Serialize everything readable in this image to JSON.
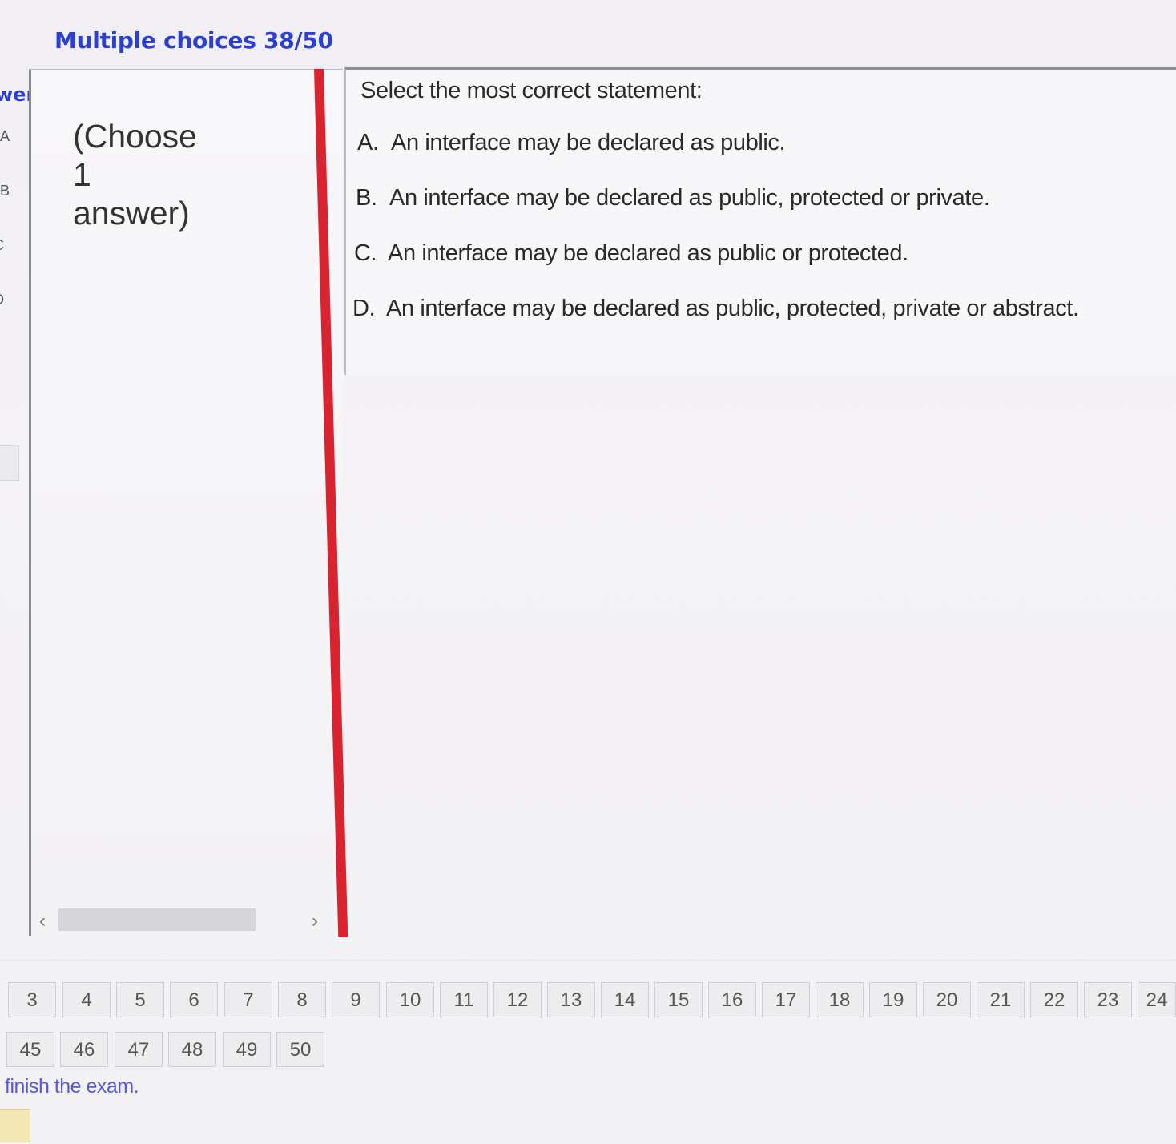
{
  "header": {
    "title": "Multiple choices 38/50"
  },
  "left_fragments": {
    "answer_label": "wer",
    "letters": [
      "A",
      "B",
      "C",
      "D"
    ]
  },
  "instruction": {
    "lines": [
      "(Choose",
      "1",
      "answer)"
    ]
  },
  "question": {
    "text": "Select the most correct statement:",
    "options": [
      {
        "letter": "A.",
        "text": "An interface may be declared as public."
      },
      {
        "letter": "B.",
        "text": "An interface may be declared as public, protected or private."
      },
      {
        "letter": "C.",
        "text": "An interface may be declared as public or protected."
      },
      {
        "letter": "D.",
        "text": "An interface may be declared as public, protected, private or abstract."
      }
    ]
  },
  "navigation": {
    "row1": [
      "3",
      "4",
      "5",
      "6",
      "7",
      "8",
      "9",
      "10",
      "11",
      "12",
      "13",
      "14",
      "15",
      "16",
      "17",
      "18",
      "19",
      "20",
      "21",
      "22",
      "23",
      "24"
    ],
    "row2": [
      "45",
      "46",
      "47",
      "48",
      "49",
      "50"
    ],
    "finish_label": "finish the exam."
  }
}
